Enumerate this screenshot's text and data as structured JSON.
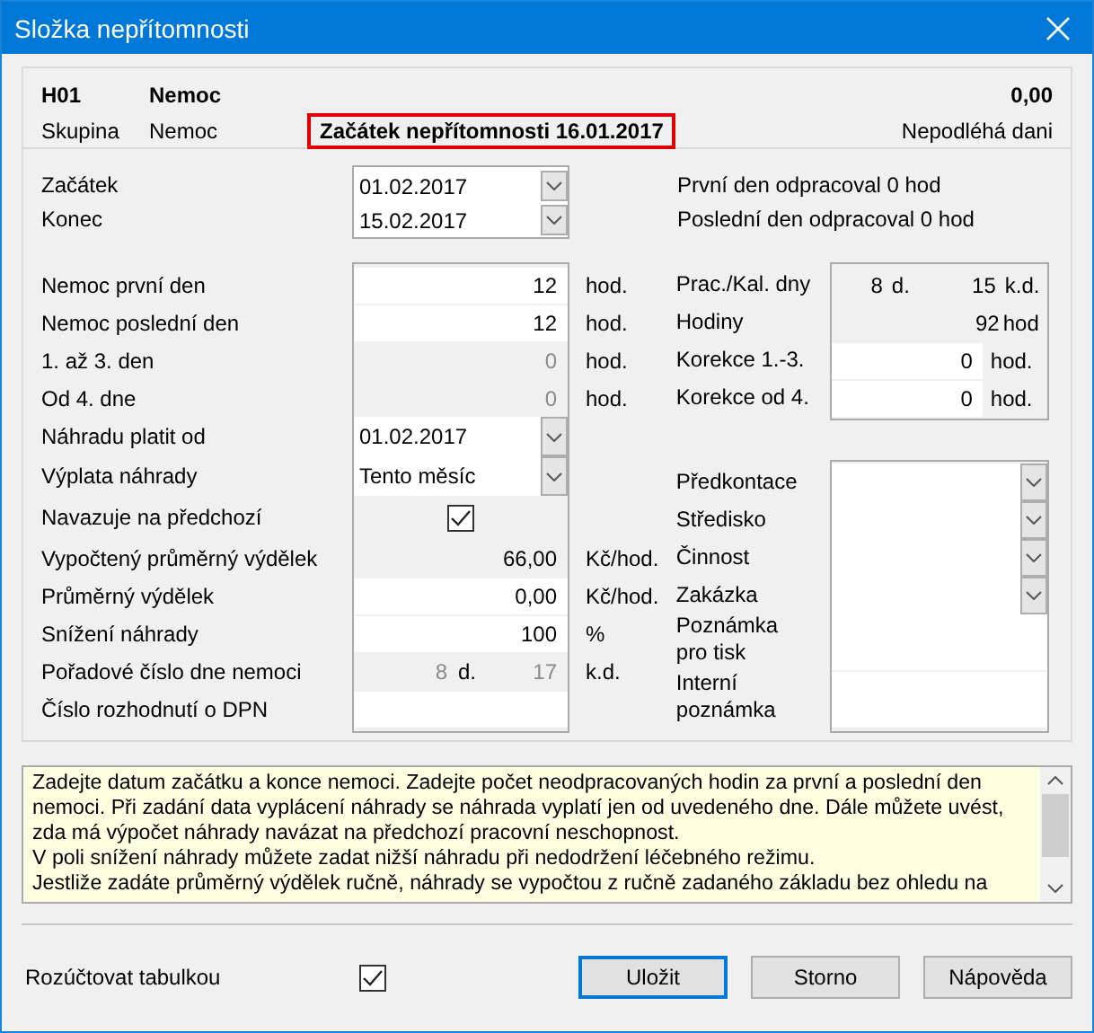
{
  "window": {
    "title": "Složka nepřítomnosti"
  },
  "header": {
    "code": "H01",
    "name": "Nemoc",
    "amount": "0,00",
    "group_label": "Skupina",
    "group": "Nemoc",
    "notice": "Začátek nepřítomnosti 16.01.2017",
    "tax_note": "Nepodléhá dani"
  },
  "dates": [
    {
      "label": "Začátek",
      "value": "01.02.2017"
    },
    {
      "label": "Konec",
      "value": "15.02.2017"
    }
  ],
  "worked_notes": [
    "První den odpracoval 0 hod",
    "Poslední den odpracoval 0 hod"
  ],
  "left_rows": [
    {
      "label": "Nemoc první den",
      "kind": "input",
      "value": "12",
      "unit": "hod."
    },
    {
      "label": "Nemoc poslední den",
      "kind": "input",
      "value": "12",
      "unit": "hod."
    },
    {
      "label": "1. až 3. den",
      "kind": "display",
      "muted": true,
      "value": "0",
      "unit": "hod."
    },
    {
      "label": "Od 4. dne",
      "kind": "display",
      "muted": true,
      "value": "0",
      "unit": "hod."
    },
    {
      "label": "Náhradu platit od",
      "kind": "combo",
      "value": "01.02.2017"
    },
    {
      "label": "Výplata náhrady",
      "kind": "combo",
      "value": "Tento měsíc"
    },
    {
      "label": "Navazuje na předchozí",
      "kind": "checkbox",
      "checked": true
    },
    {
      "label": "Vypočtený průměrný výdělek",
      "kind": "display",
      "muted": false,
      "value": "66,00",
      "unit": "Kč/hod."
    },
    {
      "label": "Průměrný výdělek",
      "kind": "input",
      "value": "0,00",
      "unit": "Kč/hod."
    },
    {
      "label": "Snížení náhrady",
      "kind": "input",
      "value": "100",
      "unit": "%"
    },
    {
      "label": "Pořadové číslo dne nemoci",
      "kind": "pair",
      "muted": true,
      "value": "8",
      "mid": "d.",
      "value2": "17",
      "unit": "k.d."
    },
    {
      "label": "Číslo rozhodnutí o DPN",
      "kind": "input"
    }
  ],
  "right_rows": [
    {
      "label": "Prac./Kal. dny",
      "kind": "pair",
      "muted": false,
      "value": "8",
      "mid": "d.",
      "value2": "15",
      "unit": "k.d."
    },
    {
      "label": "Hodiny",
      "kind": "display",
      "muted": false,
      "value": "92",
      "unit": "hod"
    },
    {
      "label": "Korekce 1.-3.",
      "kind": "input",
      "value": "0",
      "unit": "hod."
    },
    {
      "label": "Korekce od 4.",
      "kind": "input",
      "value": "0",
      "unit": "hod."
    }
  ],
  "accounts": [
    {
      "label": "Předkontace",
      "kind": "combo"
    },
    {
      "label": "Středisko",
      "kind": "combo"
    },
    {
      "label": "Činnost",
      "kind": "combo"
    },
    {
      "label": "Zakázka",
      "kind": "combo"
    },
    {
      "label": "Poznámka pro tisk",
      "kind": "memo"
    },
    {
      "label": "Interní poznámka",
      "kind": "memo"
    }
  ],
  "help": {
    "lines": [
      "Zadejte datum začátku a konce nemoci. Zadejte počet neodpracovaných hodin za první a poslední den",
      "nemoci. Při zadání data vyplácení náhrady se náhrada vyplatí jen od uvedeného dne. Dále můžete uvést,",
      "zda má výpočet náhrady navázat na předchozí pracovní neschopnost.",
      "V poli snížení náhrady můžete zadat nižší náhradu při nedodržení léčebného režimu.",
      "Jestliže zadáte průměrný výdělek ručně, náhrady se vypočtou z ručně zadaného základu bez ohledu na"
    ]
  },
  "split": {
    "label": "Rozúčtovat tabulkou",
    "checked": true
  },
  "buttons": [
    {
      "label": "Uložit",
      "default": true
    },
    {
      "label": "Storno",
      "default": false
    },
    {
      "label": "Nápověda",
      "default": false
    }
  ]
}
